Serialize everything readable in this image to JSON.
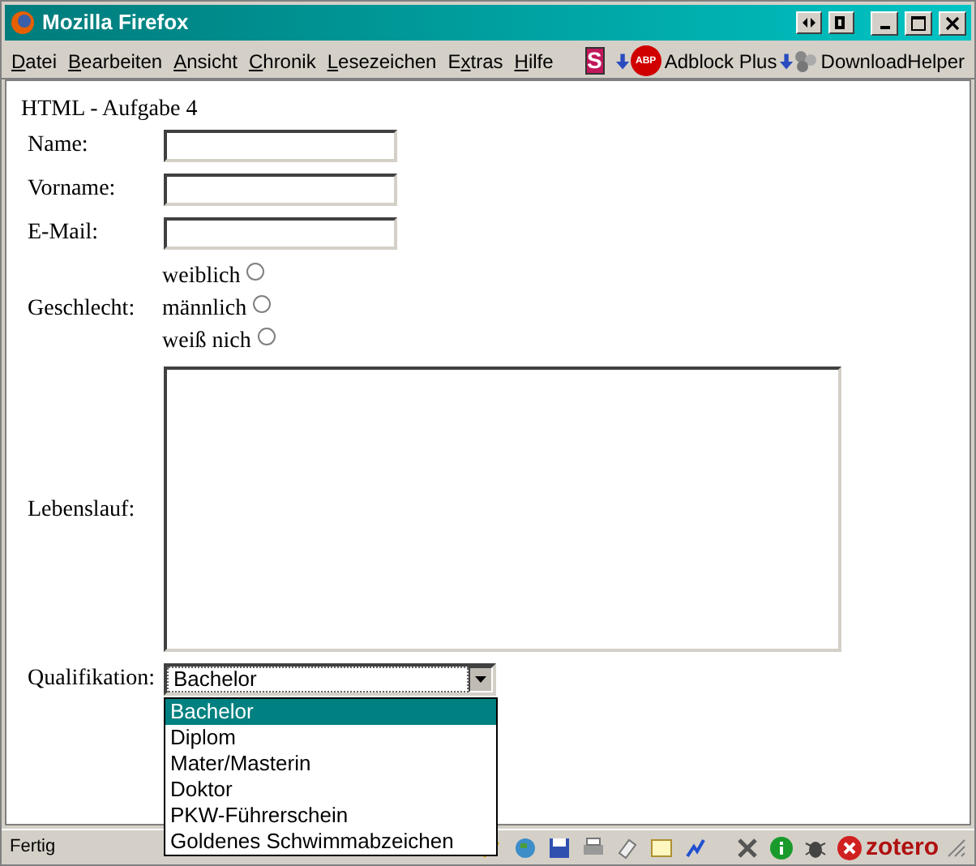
{
  "window": {
    "title": "Mozilla Firefox"
  },
  "menu": [
    {
      "key": "D",
      "post": "atei"
    },
    {
      "key": "B",
      "post": "earbeiten"
    },
    {
      "key": "A",
      "post": "nsicht"
    },
    {
      "key": "C",
      "post": "hronik"
    },
    {
      "key": "L",
      "post": "esezeichen"
    },
    {
      "pre": "E",
      "key": "x",
      "post": "tras"
    },
    {
      "key": "H",
      "post": "ilfe"
    }
  ],
  "toolbar": {
    "adblock": "Adblock Plus",
    "abp_badge": "ABP",
    "stumble": "S",
    "downloadhelper": "DownloadHelper"
  },
  "page": {
    "heading": "HTML - Aufgabe 4",
    "fields": [
      {
        "label": "Name:"
      },
      {
        "label": "Vorname:"
      },
      {
        "label": "E-Mail:"
      }
    ],
    "gender": {
      "label": "Geschlecht:",
      "options": [
        {
          "label": "weiblich",
          "selected": false
        },
        {
          "label": "männlich",
          "selected": false
        },
        {
          "label": "weiß nich",
          "selected": false
        }
      ]
    },
    "cv": {
      "label": "Lebenslauf:"
    },
    "qualification": {
      "label": "Qualifikation:",
      "value": "Bachelor",
      "expanded": true,
      "options": [
        {
          "label": "Bachelor",
          "selected": true
        },
        {
          "label": "Diplom",
          "selected": false
        },
        {
          "label": "Mater/Masterin",
          "selected": false
        },
        {
          "label": "Doktor",
          "selected": false
        },
        {
          "label": "PKW-Führerschein",
          "selected": false
        },
        {
          "label": "Goldenes Schwimmabzeichen",
          "selected": false
        }
      ]
    }
  },
  "status_bar": {
    "text": "Fertig",
    "zotero": "zotero"
  }
}
